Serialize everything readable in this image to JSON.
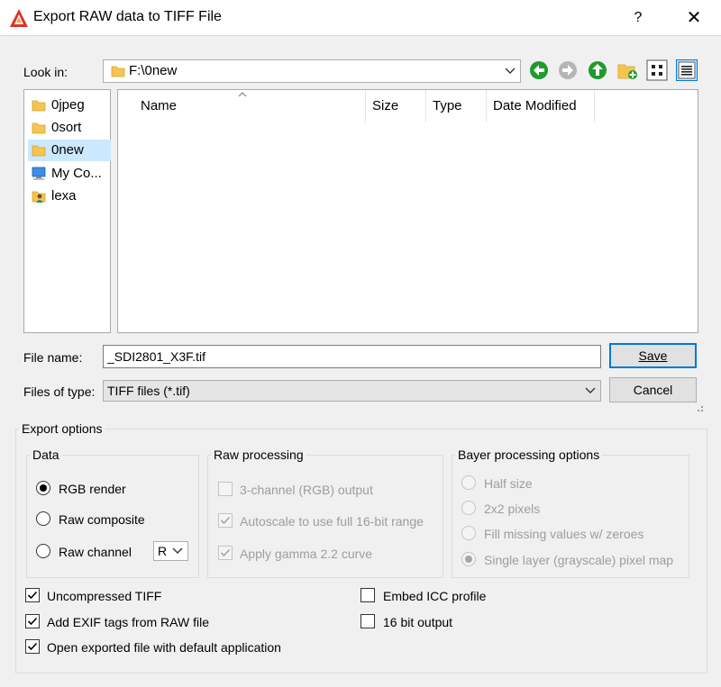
{
  "window": {
    "title": "Export RAW data to TIFF File",
    "help_label": "?",
    "close_label": "✕"
  },
  "lookin": {
    "label": "Look in:",
    "path": "F:\\0new"
  },
  "places": [
    {
      "label": "0jpeg",
      "icon": "folder-icon"
    },
    {
      "label": "0sort",
      "icon": "folder-icon"
    },
    {
      "label": "0new",
      "icon": "folder-icon",
      "selected": true
    },
    {
      "label": "My Co...",
      "icon": "computer-icon"
    },
    {
      "label": "lexa",
      "icon": "user-folder-icon"
    }
  ],
  "file_list": {
    "columns": [
      "Name",
      "Size",
      "Type",
      "Date Modified"
    ],
    "rows": []
  },
  "filename": {
    "label": "File name:",
    "value": "_SDI2801_X3F.tif"
  },
  "filetype": {
    "label": "Files of type:",
    "value": "TIFF files (*.tif)"
  },
  "buttons": {
    "save": "Save",
    "cancel": "Cancel"
  },
  "export_options": {
    "title": "Export options",
    "data": {
      "title": "Data",
      "options": [
        {
          "label": "RGB render",
          "checked": true
        },
        {
          "label": "Raw composite",
          "checked": false
        },
        {
          "label": "Raw channel",
          "checked": false
        }
      ],
      "channel": "R"
    },
    "raw_processing": {
      "title": "Raw processing",
      "options": [
        {
          "label": "3-channel (RGB) output",
          "checked": false
        },
        {
          "label": "Autoscale to use full 16-bit range",
          "checked": true
        },
        {
          "label": "Apply gamma 2.2 curve",
          "checked": true
        }
      ]
    },
    "bayer": {
      "title": "Bayer processing options",
      "options": [
        {
          "label": "Half size",
          "checked": false
        },
        {
          "label": "2x2 pixels",
          "checked": false
        },
        {
          "label": "Fill missing values w/ zeroes",
          "checked": false
        },
        {
          "label": "Single layer (grayscale) pixel map",
          "checked": true
        }
      ]
    },
    "checks": {
      "uncompressed": "Uncompressed TIFF",
      "exif": "Add EXIF tags from RAW file",
      "open": "Open exported file with default application",
      "icc": "Embed ICC profile",
      "bit16": "16 bit output"
    }
  },
  "colors": {
    "accent": "#0078d7",
    "selection": "#cce8ff",
    "nav_green": "#1e9b2e"
  }
}
